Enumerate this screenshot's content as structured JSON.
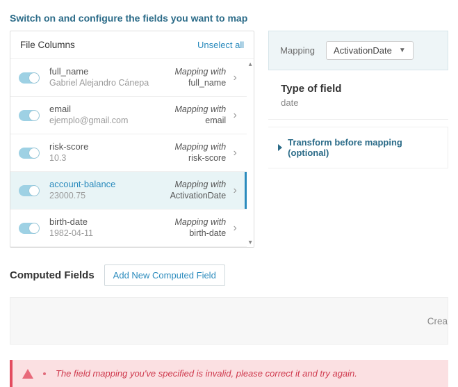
{
  "page": {
    "title": "Switch on and configure the fields you want to map"
  },
  "filecols": {
    "header": "File Columns",
    "unselect": "Unselect all",
    "mapping_with_label": "Mapping with",
    "rows": [
      {
        "name": "full_name",
        "sample": "Gabriel Alejandro Cánepa",
        "maps_to": "full_name",
        "selected": false
      },
      {
        "name": "email",
        "sample": "ejemplo@gmail.com",
        "maps_to": "email",
        "selected": false
      },
      {
        "name": "risk-score",
        "sample": "10.3",
        "maps_to": "risk-score",
        "selected": false
      },
      {
        "name": "account-balance",
        "sample": "23000.75",
        "maps_to": "ActivationDate",
        "selected": true
      },
      {
        "name": "birth-date",
        "sample": "1982-04-11",
        "maps_to": "birth-date",
        "selected": false
      }
    ]
  },
  "mapping_panel": {
    "label": "Mapping",
    "selected_value": "ActivationDate",
    "type_heading": "Type of field",
    "type_value": "date",
    "transform_label": "Transform before mapping (optional)"
  },
  "computed": {
    "heading": "Computed Fields",
    "add_button": "Add New Computed Field",
    "placeholder_hint": "Crea"
  },
  "error": {
    "message": "The field mapping you've specified is invalid, please correct it and try again."
  }
}
